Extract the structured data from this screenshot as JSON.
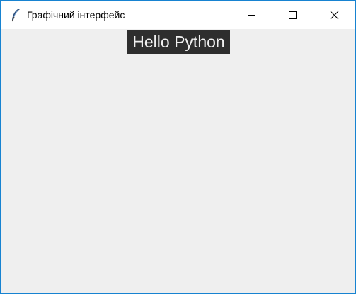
{
  "window": {
    "title": "Графічний інтерфейс",
    "app_icon": "feather-icon",
    "controls": {
      "minimize_icon": "minimize-icon",
      "maximize_icon": "maximize-icon",
      "close_icon": "close-icon"
    }
  },
  "main": {
    "label_text": "Hello Python",
    "label_bg": "#2e2e2e",
    "label_fg": "#f0f0f0"
  },
  "colors": {
    "window_border": "#1783d1",
    "client_bg": "#efefef",
    "titlebar_bg": "#ffffff"
  }
}
